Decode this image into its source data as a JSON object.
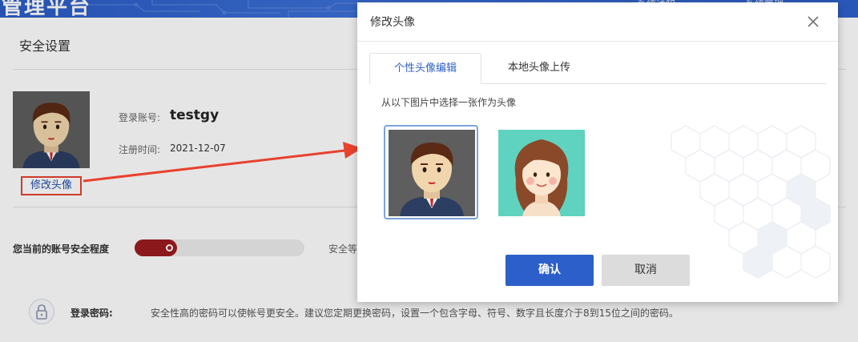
{
  "app": {
    "brand": "管理平台",
    "nav_items": [
      "系统通知",
      "系统管理"
    ]
  },
  "settings": {
    "section_title": "安全设置",
    "avatar_edit_label": "修改头像",
    "account_label": "登录账号:",
    "account_value": "testgy",
    "register_label": "注册时间:",
    "register_value": "2021-12-07",
    "safety_label": "您当前的账号安全程度",
    "safety_level_fraction": 0.25,
    "safety_level_text": "安全等",
    "password_label": "登录密码:",
    "password_desc": "安全性高的密码可以使帐号更安全。建议您定期更换密码，设置一个包含字母、符号、数字且长度介于8到15位之间的密码。"
  },
  "modal": {
    "title": "修改头像",
    "tabs": [
      {
        "label": "个性头像编辑",
        "active": true
      },
      {
        "label": "本地头像上传",
        "active": false
      }
    ],
    "hint": "从以下图片中选择一张作为头像",
    "avatars": [
      {
        "name": "male-avatar",
        "selected": true
      },
      {
        "name": "female-avatar",
        "selected": false
      }
    ],
    "confirm_label": "确认",
    "cancel_label": "取消"
  },
  "colors": {
    "primary": "#2c5fc9",
    "annotation_red": "#e8412d",
    "safety_bar": "#9b1c1f",
    "female_bg": "#5fd3c0",
    "male_bg": "#5e5e5e"
  }
}
